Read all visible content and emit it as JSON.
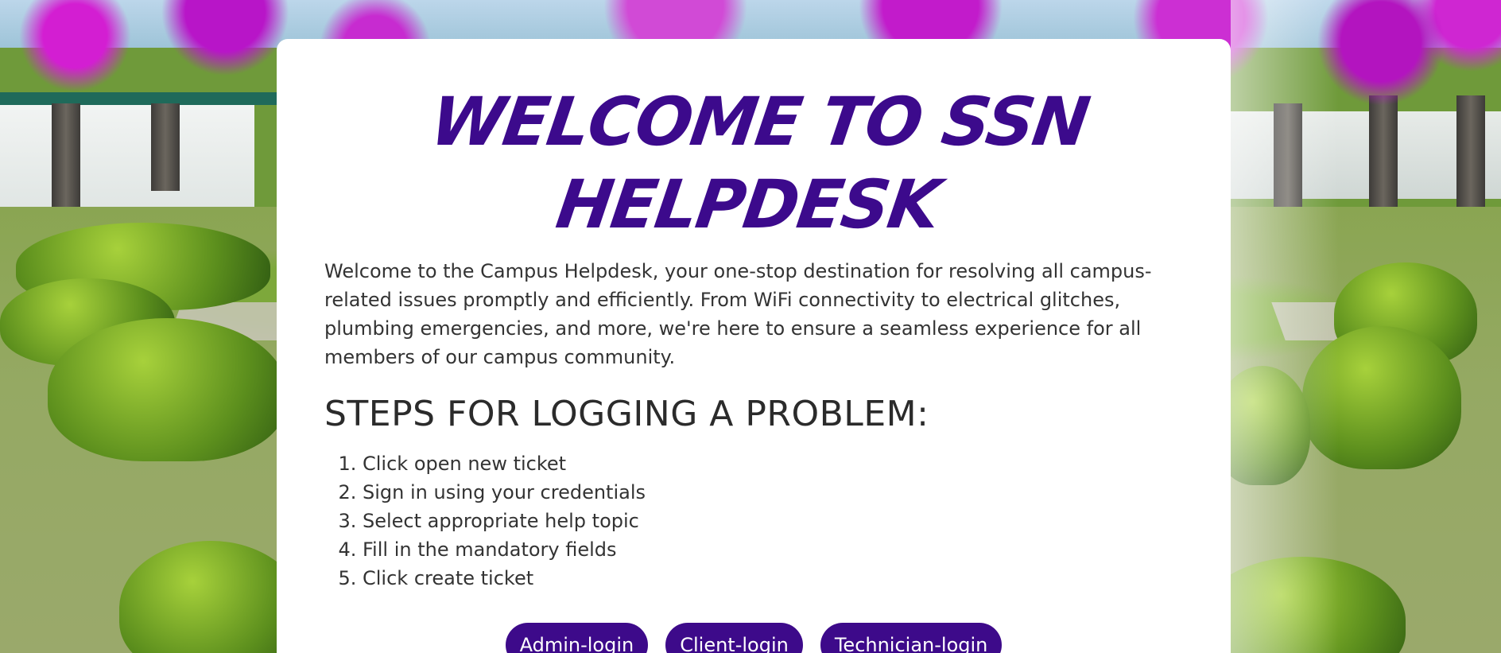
{
  "page": {
    "title": "WELCOME TO SSN HELPDESK",
    "intro": "Welcome to the Campus Helpdesk, your one-stop destination for resolving all campus-related issues promptly and efficiently. From WiFi connectivity to electrical glitches, plumbing emergencies, and more, we're here to ensure a seamless experience for all members of our campus community.",
    "steps_heading": "STEPS FOR LOGGING A PROBLEM:",
    "steps": [
      "Click open new ticket",
      "Sign in using your credentials",
      "Select appropriate help topic",
      "Fill in the mandatory fields",
      "Click create ticket"
    ]
  },
  "buttons": {
    "admin_label": "Admin-login",
    "client_label": "Client-login",
    "technician_label": "Technician-login"
  },
  "colors": {
    "accent": "#3d0a8a",
    "title": "#3c0a8c",
    "card_bg": "#ffffff",
    "text": "#333333"
  }
}
